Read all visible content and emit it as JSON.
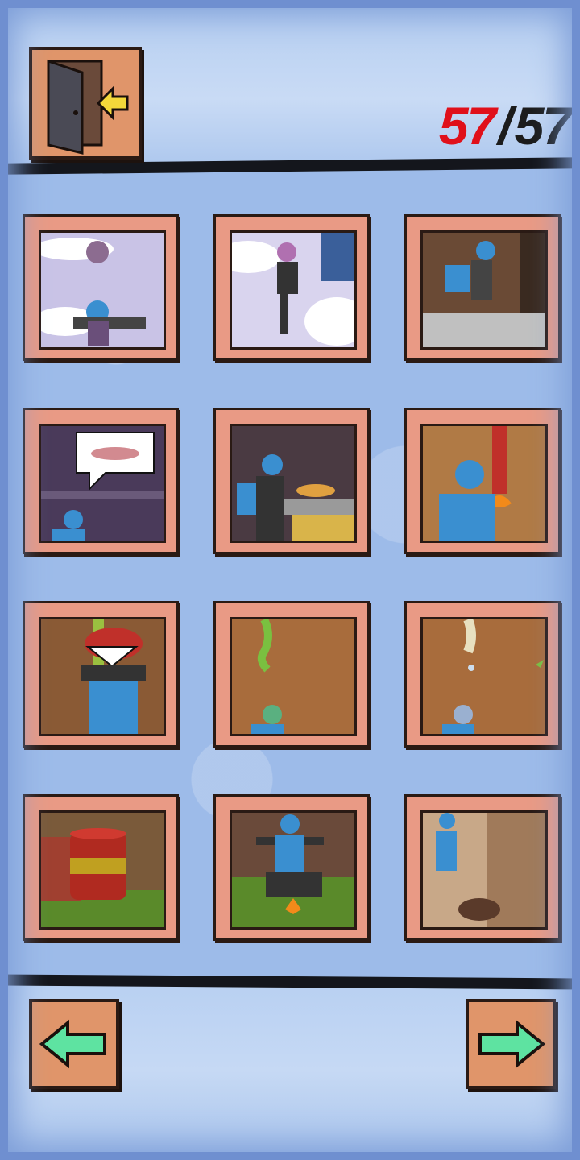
{
  "header": {
    "exit_icon": "exit-door-icon",
    "progress": {
      "current": "57",
      "separator": "/",
      "total": "57"
    }
  },
  "gallery": {
    "cards": [
      {
        "scene": "skydive-1"
      },
      {
        "scene": "skydive-2"
      },
      {
        "scene": "forest-run"
      },
      {
        "scene": "kitchen-bubble"
      },
      {
        "scene": "kitchen-cook"
      },
      {
        "scene": "fire-pillar"
      },
      {
        "scene": "monster-attack"
      },
      {
        "scene": "drip-wall-1"
      },
      {
        "scene": "drip-wall-2"
      },
      {
        "scene": "barrel-yard"
      },
      {
        "scene": "explosion-dance"
      },
      {
        "scene": "dog-alley"
      }
    ]
  },
  "footer": {
    "prev_icon": "arrow-left-icon",
    "next_icon": "arrow-right-icon"
  },
  "colors": {
    "panel": "#e99a85",
    "button": "#e0956a",
    "counter_current": "#e0101a",
    "arrow": "#5ee3a1"
  }
}
